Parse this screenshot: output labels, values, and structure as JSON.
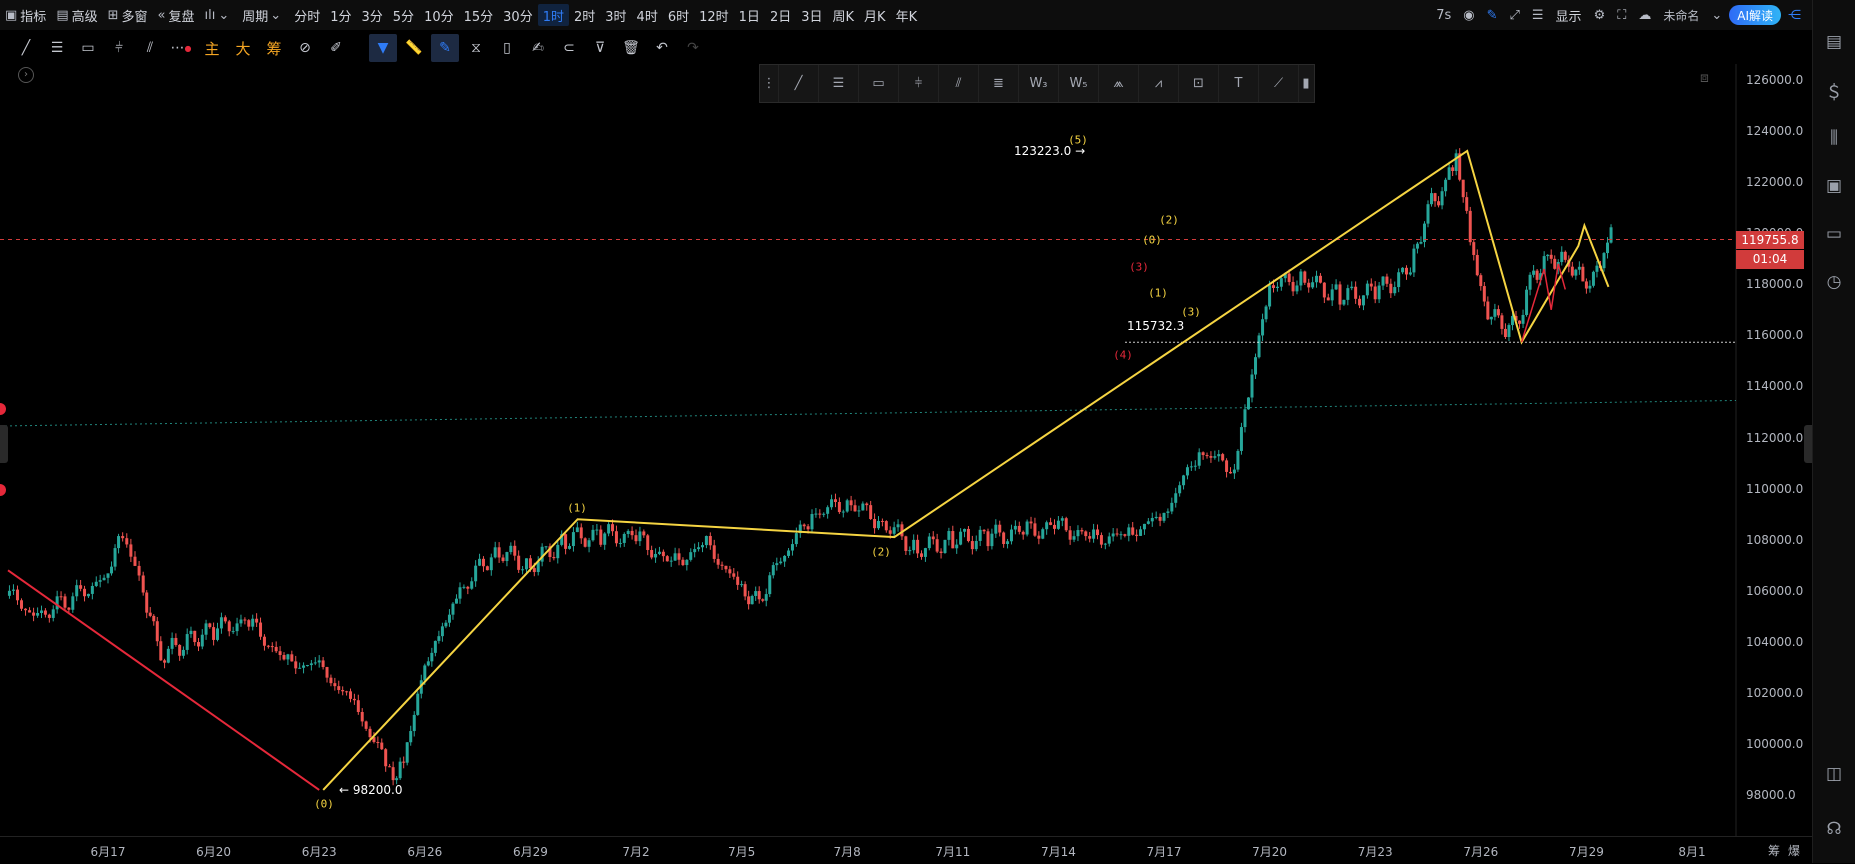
{
  "toolbar": {
    "indicators": "指标",
    "advanced": "高级",
    "multi_window": "多窗",
    "replay": "复盘",
    "period": "周期",
    "intervals": [
      "分时",
      "1分",
      "3分",
      "5分",
      "10分",
      "15分",
      "30分",
      "1时",
      "2时",
      "3时",
      "4时",
      "6时",
      "12时",
      "1日",
      "2日",
      "3日",
      "周K",
      "月K",
      "年K"
    ],
    "active_interval": "1时",
    "refresh": "7s",
    "display": "显示",
    "unnamed": "未命名",
    "ai": "AI解读"
  },
  "drawing_tools": {
    "main_label": "主",
    "big_label": "大",
    "chip_label": "筹"
  },
  "chart_data": {
    "type": "candlestick",
    "x_tick_labels": [
      "6月17",
      "6月20",
      "6月23",
      "6月26",
      "6月29",
      "7月2",
      "7月5",
      "7月8",
      "7月11",
      "7月14",
      "7月17",
      "7月20",
      "7月23",
      "7月26",
      "7月29",
      "8月1"
    ],
    "y_tick_labels": [
      "126000.0",
      "124000.0",
      "122000.0",
      "120000.0",
      "118000.0",
      "116000.0",
      "114000.0",
      "112000.0",
      "110000.0",
      "108000.0",
      "106000.0",
      "104000.0",
      "102000.0",
      "100000.0",
      "98000.0"
    ],
    "ylim": [
      97000,
      126500
    ],
    "current_price": "119755.8",
    "countdown": "01:04",
    "price_annotations": [
      {
        "label": "98200.0",
        "value": 98200
      },
      {
        "label": "123223.0",
        "value": 123223
      },
      {
        "label": "115732.3",
        "value": 115732.3
      }
    ],
    "elliott_wave_yellow": [
      {
        "label": "(0)",
        "x": "6月23",
        "y": 98200
      },
      {
        "label": "(1)",
        "x": "6月30",
        "y": 108800
      },
      {
        "label": "(2)",
        "x": "7月9",
        "y": 108100
      },
      {
        "label": "(3)",
        "x": "",
        "y": null
      },
      {
        "label": "(5)",
        "x": "7月14",
        "y": 123223
      },
      {
        "label": "(4)",
        "x": "7月15",
        "y": 115732
      }
    ],
    "sub_wave_labels": [
      "(0)",
      "(1)",
      "(2)",
      "(3)"
    ],
    "red_trendline": {
      "from": "6月15",
      "from_value": 106800,
      "to": "6月23",
      "to_value": 98200
    }
  },
  "bottom_tail": [
    "筹",
    "爆"
  ]
}
